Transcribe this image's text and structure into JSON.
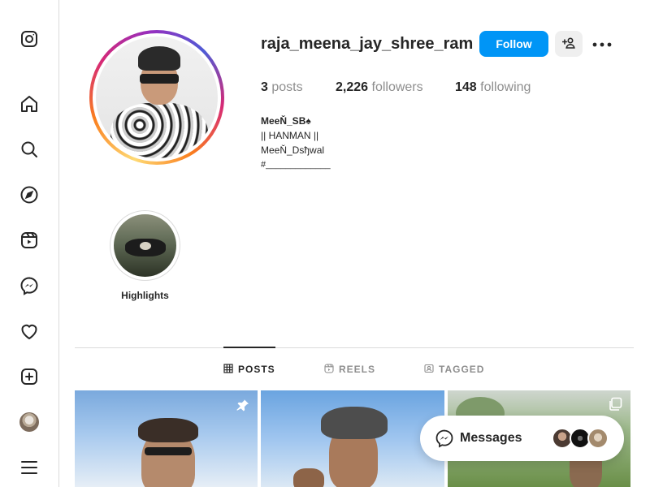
{
  "nav": {
    "items": [
      {
        "id": "instagram",
        "icon": "instagram-logo-icon"
      },
      {
        "id": "home",
        "icon": "home-icon"
      },
      {
        "id": "search",
        "icon": "search-icon"
      },
      {
        "id": "explore",
        "icon": "compass-icon"
      },
      {
        "id": "reels",
        "icon": "reels-icon"
      },
      {
        "id": "messages",
        "icon": "messenger-icon"
      },
      {
        "id": "notifications",
        "icon": "heart-icon"
      },
      {
        "id": "create",
        "icon": "plus-square-icon"
      },
      {
        "id": "profile",
        "icon": "avatar"
      },
      {
        "id": "more",
        "icon": "hamburger-menu-icon"
      }
    ]
  },
  "profile": {
    "username": "raja_meena_jay_shree_ram",
    "follow_label": "Follow",
    "stats": {
      "posts_count": "3",
      "posts_label": "posts",
      "followers_count": "2,226",
      "followers_label": "followers",
      "following_count": "148",
      "following_label": "following"
    },
    "bio": {
      "display_name": "MeeŇ_SB♠",
      "line1": "|| HANMAN ||",
      "line2": "MeeŇ_Dsђwal",
      "line3": "#_____________"
    }
  },
  "highlights": [
    {
      "label": "Highlights"
    }
  ],
  "tabs": [
    {
      "label": "POSTS",
      "icon": "grid-icon",
      "active": true
    },
    {
      "label": "REELS",
      "icon": "reels-icon",
      "active": false
    },
    {
      "label": "TAGGED",
      "icon": "tagged-icon",
      "active": false
    }
  ],
  "messages_bar": {
    "label": "Messages"
  },
  "colors": {
    "accent": "#0095f6",
    "text": "#262626",
    "muted": "#8e8e8e",
    "border": "#dbdbdb"
  }
}
